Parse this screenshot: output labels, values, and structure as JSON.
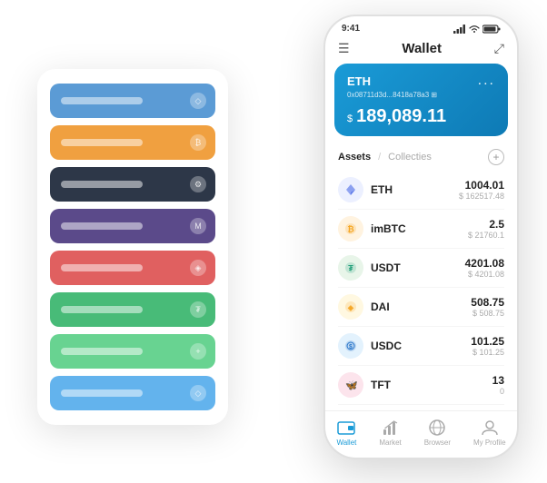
{
  "statusBar": {
    "time": "9:41",
    "signalBars": [
      3,
      4,
      5
    ],
    "wifiIcon": "wifi",
    "batteryIcon": "battery"
  },
  "topNav": {
    "menuIcon": "☰",
    "title": "Wallet",
    "expandIcon": "⤢"
  },
  "ethCard": {
    "label": "ETH",
    "moreIcon": "...",
    "address": "0x08711d3d...8418a78a3  ⊞",
    "currencySymbol": "$",
    "balance": "189,089.11"
  },
  "assetsTabs": {
    "activeTab": "Assets",
    "divider": "/",
    "inactiveTab": "Collecties",
    "addIcon": "+"
  },
  "assets": [
    {
      "symbol": "ETH",
      "iconLabel": "◇",
      "amount": "1004.01",
      "value": "$ 162517.48"
    },
    {
      "symbol": "imBTC",
      "iconLabel": "₿",
      "amount": "2.5",
      "value": "$ 21760.1"
    },
    {
      "symbol": "USDT",
      "iconLabel": "₮",
      "amount": "4201.08",
      "value": "$ 4201.08"
    },
    {
      "symbol": "DAI",
      "iconLabel": "◈",
      "amount": "508.75",
      "value": "$ 508.75"
    },
    {
      "symbol": "USDC",
      "iconLabel": "©",
      "amount": "101.25",
      "value": "$ 101.25"
    },
    {
      "symbol": "TFT",
      "iconLabel": "🦋",
      "amount": "13",
      "value": "0"
    }
  ],
  "bottomNav": [
    {
      "icon": "💳",
      "label": "Wallet",
      "active": true
    },
    {
      "icon": "📊",
      "label": "Market",
      "active": false
    },
    {
      "icon": "🌐",
      "label": "Browser",
      "active": false
    },
    {
      "icon": "👤",
      "label": "My Profile",
      "active": false
    }
  ],
  "cardList": [
    {
      "color": "card-blue",
      "iconText": "◇"
    },
    {
      "color": "card-orange",
      "iconText": "₿"
    },
    {
      "color": "card-dark",
      "iconText": "⚙"
    },
    {
      "color": "card-purple",
      "iconText": "M"
    },
    {
      "color": "card-red",
      "iconText": "◈"
    },
    {
      "color": "card-green",
      "iconText": "₮"
    },
    {
      "color": "card-lightgreen",
      "iconText": "+"
    },
    {
      "color": "card-skyblue",
      "iconText": "◇"
    }
  ]
}
